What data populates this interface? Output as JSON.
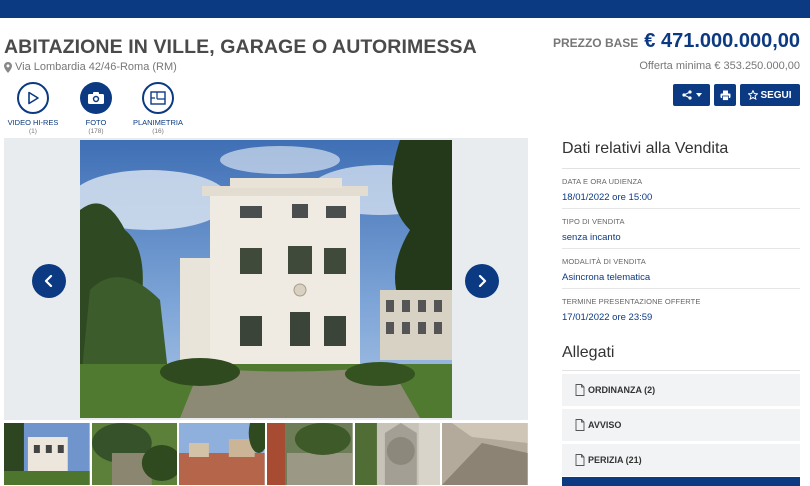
{
  "listing": {
    "title": "ABITAZIONE IN VILLE, GARAGE O AUTORIMESSA",
    "address": "Via Lombardia 42/46-Roma (RM)",
    "price_label": "PREZZO BASE",
    "price": "€ 471.000.000,00",
    "min_offer": "Offerta minima € 353.250.000,00"
  },
  "media": [
    {
      "label": "VIDEO HI-RES",
      "count": "(1)",
      "icon": "play-icon"
    },
    {
      "label": "FOTO",
      "count": "(178)",
      "icon": "camera-icon"
    },
    {
      "label": "PLANIMETRIA",
      "count": "(16)",
      "icon": "floorplan-icon"
    }
  ],
  "actions": {
    "follow_label": "SEGUI"
  },
  "sale": {
    "title": "Dati relativi alla Vendita",
    "rows": [
      {
        "label": "DATA E ORA UDIENZA",
        "value": "18/01/2022 ore 15:00"
      },
      {
        "label": "TIPO DI VENDITA",
        "value": "senza incanto"
      },
      {
        "label": "MODALITÀ DI VENDITA",
        "value": "Asincrona telematica"
      },
      {
        "label": "TERMINE PRESENTAZIONE OFFERTE",
        "value": "17/01/2022 ore 23:59"
      }
    ]
  },
  "attachments": {
    "title": "Allegati",
    "items": [
      {
        "label": "ORDINANZA (2)"
      },
      {
        "label": "AVVISO"
      },
      {
        "label": "PERIZIA (21)"
      }
    ]
  },
  "colors": {
    "brand": "#0b3a82",
    "panel": "#f1f3f5"
  }
}
